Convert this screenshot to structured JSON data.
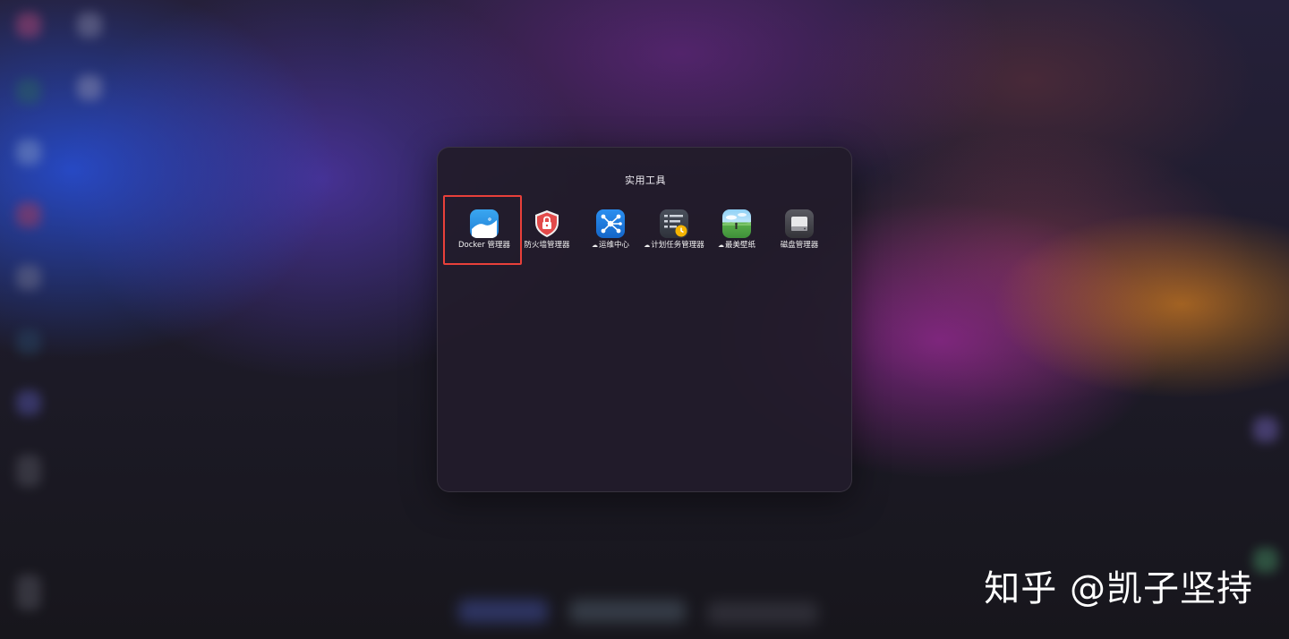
{
  "folder": {
    "title": "实用工具",
    "apps": [
      {
        "id": "docker",
        "label": "Docker 管理器",
        "icon": "docker-whale-icon",
        "cloud": false,
        "selected": true
      },
      {
        "id": "firewall",
        "label": "防火墙管理器",
        "icon": "lock-shield-icon",
        "cloud": false,
        "selected": false
      },
      {
        "id": "ops",
        "label": "运维中心",
        "icon": "network-nodes-icon",
        "cloud": true,
        "selected": false
      },
      {
        "id": "scheduler",
        "label": "计划任务管理器",
        "icon": "task-clock-icon",
        "cloud": true,
        "selected": false
      },
      {
        "id": "wallpaper",
        "label": "最美壁纸",
        "icon": "landscape-icon",
        "cloud": true,
        "selected": false
      },
      {
        "id": "disk",
        "label": "磁盘管理器",
        "icon": "hard-disk-icon",
        "cloud": false,
        "selected": false
      }
    ]
  },
  "watermark": "知乎 @凯子坚持",
  "colors": {
    "highlight": "#e8403a",
    "panel": "#221c2a",
    "docker_icon": "#2a8fe0",
    "firewall_icon": "#e24a4a",
    "ops_icon": "#1f7fe0",
    "scheduler_icon": "#3a3f4a",
    "disk_icon": "#4a4a50"
  }
}
